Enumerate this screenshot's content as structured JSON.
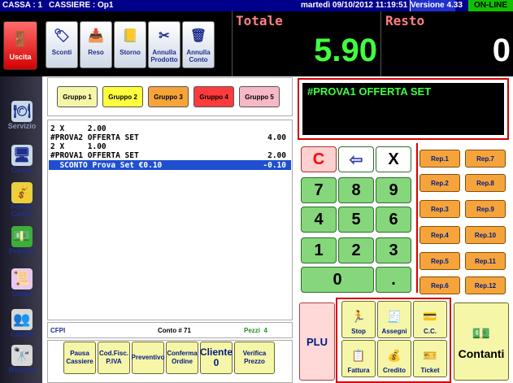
{
  "status_bar": {
    "cassa": "CASSA : 1",
    "cassiere": "CASSIERE : Op1",
    "datetime": "martedì 09/10/2012 11:19:51",
    "version": "Versione 4.33",
    "online": "ON-LINE"
  },
  "totals": {
    "totale_label": "Totale",
    "totale_value": "5.90",
    "resto_label": "Resto",
    "resto_value": "0"
  },
  "toolbar": {
    "uscita": "Uscita",
    "sconti": "Sconti",
    "reso": "Reso",
    "storno": "Storno",
    "annulla_prodotto": "Annulla Prodotto",
    "annulla_conto": "Annulla Conto"
  },
  "groups": [
    {
      "label": "Gruppo 1",
      "color": "#f6f6a8"
    },
    {
      "label": "Gruppo 2",
      "color": "#ffff3c"
    },
    {
      "label": "Gruppo 3",
      "color": "#f6a43a"
    },
    {
      "label": "Gruppo 4",
      "color": "#ff3b3b"
    },
    {
      "label": "Gruppo 5",
      "color": "#f6b8c6"
    }
  ],
  "receipt": [
    {
      "left": "2 X     2.00",
      "right": ""
    },
    {
      "left": "#PROVA2 OFFERTA SET",
      "right": "4.00"
    },
    {
      "left": "2 X     1.00",
      "right": ""
    },
    {
      "left": "#PROVA1 OFFERTA SET",
      "right": "2.00"
    },
    {
      "left": "  SCONTO Prova Set €0.10",
      "right": "-0.10"
    }
  ],
  "display_text": "#PROVA1 OFFERTA SET",
  "keypad": {
    "c": "C",
    "back": "⇦",
    "x": "X",
    "k7": "7",
    "k8": "8",
    "k9": "9",
    "k4": "4",
    "k5": "5",
    "k6": "6",
    "k1": "1",
    "k2": "2",
    "k3": "3",
    "k0": "0",
    "dot": "."
  },
  "reps": [
    "Rep.1",
    "Rep.7",
    "Rep.2",
    "Rep.8",
    "Rep.3",
    "Rep.9",
    "Rep.4",
    "Rep.10",
    "Rep.5",
    "Rep.11",
    "Rep.6",
    "Rep.12"
  ],
  "sidebar": {
    "servizio": "Servizio",
    "cassa": "Cassa",
    "fondo_cassa": "Fondo Cassa",
    "prelievi": "Prelievi",
    "copia": "Copia",
    "clienti": "Clienti",
    "ricerca": "Ricerca"
  },
  "info": {
    "client": "CFPI",
    "conto": "Conto # 71",
    "pezzi": "Pezzi  4"
  },
  "bottom": {
    "pausa": "Pausa Cassiere",
    "codfisc": "Cod.Fisc. P.IVA",
    "preventivo": "Preventivo",
    "conferma": "Conferma Ordine",
    "cliente_label": "Cliente",
    "cliente_value": "0",
    "verifica": "Verifica Prezzo"
  },
  "payments": {
    "plu": "PLU",
    "stop": "Stop",
    "assegni": "Assegni",
    "cc": "C.C.",
    "contanti": "Contanti",
    "fattura": "Fattura",
    "credito": "Credito",
    "ticket": "Ticket"
  },
  "colors": {
    "bar": "#00008b",
    "green_digits": "#3fff3f",
    "accent_red": "#ff0000"
  }
}
